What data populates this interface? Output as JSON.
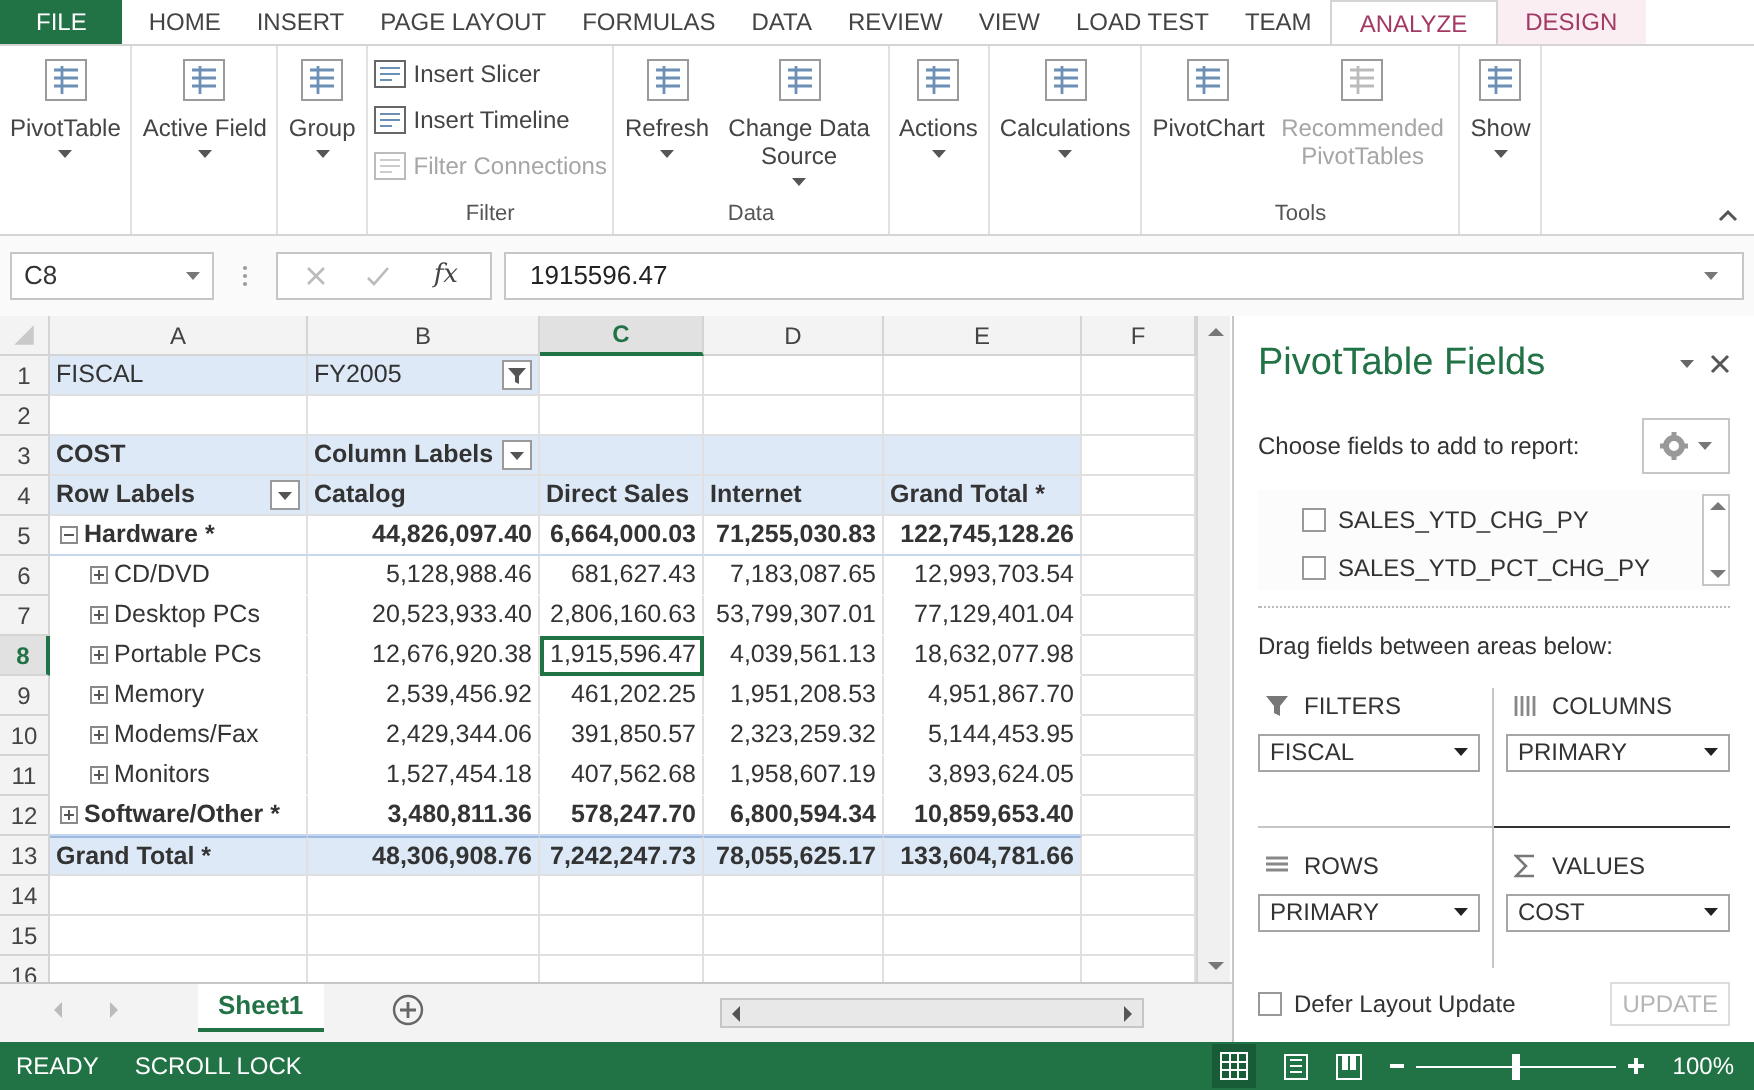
{
  "menu_tabs": [
    {
      "label": "FILE",
      "kind": "file",
      "selected": false
    },
    {
      "label": "HOME",
      "kind": "normal",
      "selected": false
    },
    {
      "label": "INSERT",
      "kind": "normal",
      "selected": false
    },
    {
      "label": "PAGE LAYOUT",
      "kind": "normal",
      "selected": false
    },
    {
      "label": "FORMULAS",
      "kind": "normal",
      "selected": false
    },
    {
      "label": "DATA",
      "kind": "normal",
      "selected": false
    },
    {
      "label": "REVIEW",
      "kind": "normal",
      "selected": false
    },
    {
      "label": "VIEW",
      "kind": "normal",
      "selected": false
    },
    {
      "label": "LOAD TEST",
      "kind": "normal",
      "selected": false
    },
    {
      "label": "TEAM",
      "kind": "normal",
      "selected": false
    },
    {
      "label": "ANALYZE",
      "kind": "context",
      "selected": true
    },
    {
      "label": "DESIGN",
      "kind": "context",
      "selected": false
    }
  ],
  "ribbon_groups": [
    {
      "kind": "large",
      "buttons": [
        {
          "label": "PivotTable",
          "caret": true,
          "disabled": false
        }
      ]
    },
    {
      "kind": "large",
      "buttons": [
        {
          "label": "Active Field",
          "caret": true,
          "disabled": false
        }
      ]
    },
    {
      "kind": "large",
      "buttons": [
        {
          "label": "Group",
          "caret": true,
          "disabled": false
        }
      ]
    },
    {
      "kind": "small",
      "label": "Filter",
      "buttons": [
        {
          "label": "Insert Slicer",
          "disabled": false
        },
        {
          "label": "Insert Timeline",
          "disabled": false
        },
        {
          "label": "Filter Connections",
          "disabled": true
        }
      ]
    },
    {
      "kind": "large",
      "label": "Data",
      "buttons": [
        {
          "label": "Refresh",
          "caret": true,
          "disabled": false
        },
        {
          "label": "Change Data Source",
          "caret": true,
          "disabled": false
        }
      ]
    },
    {
      "kind": "large",
      "buttons": [
        {
          "label": "Actions",
          "caret": true,
          "disabled": false
        }
      ]
    },
    {
      "kind": "large",
      "buttons": [
        {
          "label": "Calculations",
          "caret": true,
          "disabled": false
        }
      ]
    },
    {
      "kind": "large",
      "label": "Tools",
      "buttons": [
        {
          "label": "PivotChart",
          "caret": false,
          "disabled": false
        },
        {
          "label": "Recommended PivotTables",
          "caret": false,
          "disabled": true
        }
      ]
    },
    {
      "kind": "large",
      "buttons": [
        {
          "label": "Show",
          "caret": true,
          "disabled": false
        }
      ]
    }
  ],
  "formula_bar": {
    "name_box": "C8",
    "function_label": "fx",
    "value": "1915596.47"
  },
  "columns": [
    {
      "label": "A",
      "selected": false
    },
    {
      "label": "B",
      "selected": false
    },
    {
      "label": "C",
      "selected": true
    },
    {
      "label": "D",
      "selected": false
    },
    {
      "label": "E",
      "selected": false
    },
    {
      "label": "F",
      "selected": false
    }
  ],
  "rows": [
    {
      "num": "1",
      "kind": "filter",
      "selected": false,
      "cells": [
        "FISCAL",
        "FY2005"
      ]
    },
    {
      "num": "2",
      "kind": "empty",
      "selected": false
    },
    {
      "num": "3",
      "kind": "caption",
      "selected": false,
      "cells": [
        "COST",
        "Column Labels"
      ]
    },
    {
      "num": "4",
      "kind": "colheads",
      "selected": false,
      "cells": [
        "Row Labels",
        "Catalog",
        "Direct Sales",
        "Internet",
        "Grand Total *"
      ]
    },
    {
      "num": "5",
      "kind": "group",
      "expanded": true,
      "selected": false,
      "cells": [
        "Hardware *",
        "44,826,097.40",
        "6,664,000.03",
        "71,255,030.83",
        "122,745,128.26"
      ]
    },
    {
      "num": "6",
      "kind": "item",
      "expanded": false,
      "selected": false,
      "cells": [
        "CD/DVD",
        "5,128,988.46",
        "681,627.43",
        "7,183,087.65",
        "12,993,703.54"
      ]
    },
    {
      "num": "7",
      "kind": "item",
      "expanded": false,
      "selected": false,
      "cells": [
        "Desktop PCs",
        "20,523,933.40",
        "2,806,160.63",
        "53,799,307.01",
        "77,129,401.04"
      ]
    },
    {
      "num": "8",
      "kind": "item",
      "expanded": false,
      "selected": true,
      "cells": [
        "Portable PCs",
        "12,676,920.38",
        "1,915,596.47",
        "4,039,561.13",
        "18,632,077.98"
      ]
    },
    {
      "num": "9",
      "kind": "item",
      "expanded": false,
      "selected": false,
      "cells": [
        "Memory",
        "2,539,456.92",
        "461,202.25",
        "1,951,208.53",
        "4,951,867.70"
      ]
    },
    {
      "num": "10",
      "kind": "item",
      "expanded": false,
      "selected": false,
      "cells": [
        "Modems/Fax",
        "2,429,344.06",
        "391,850.57",
        "2,323,259.32",
        "5,144,453.95"
      ]
    },
    {
      "num": "11",
      "kind": "item",
      "expanded": false,
      "selected": false,
      "cells": [
        "Monitors",
        "1,527,454.18",
        "407,562.68",
        "1,958,607.19",
        "3,893,624.05"
      ]
    },
    {
      "num": "12",
      "kind": "group",
      "expanded": false,
      "selected": false,
      "cells": [
        "Software/Other *",
        "3,480,811.36",
        "578,247.70",
        "6,800,594.34",
        "10,859,653.40"
      ]
    },
    {
      "num": "13",
      "kind": "total",
      "selected": false,
      "cells": [
        "Grand Total *",
        "48,306,908.76",
        "7,242,247.73",
        "78,055,625.17",
        "133,604,781.66"
      ]
    },
    {
      "num": "14",
      "kind": "empty",
      "selected": false
    },
    {
      "num": "15",
      "kind": "empty",
      "selected": false
    },
    {
      "num": "16",
      "kind": "empty",
      "selected": false
    }
  ],
  "sheet_tabs": [
    {
      "label": "Sheet1",
      "selected": true
    }
  ],
  "pane": {
    "title": "PivotTable Fields",
    "subtitle": "Choose fields to add to report:",
    "fields": [
      {
        "label": "SALES_YTD_CHG_PY",
        "checked": false
      },
      {
        "label": "SALES_YTD_PCT_CHG_PY",
        "checked": false
      }
    ],
    "drag_hint": "Drag fields between areas below:",
    "areas": [
      {
        "kind": "filters",
        "label": "FILTERS",
        "fields": [
          "FISCAL"
        ]
      },
      {
        "kind": "columns",
        "label": "COLUMNS",
        "fields": [
          "PRIMARY"
        ]
      },
      {
        "kind": "rows",
        "label": "ROWS",
        "fields": [
          "PRIMARY"
        ]
      },
      {
        "kind": "values",
        "label": "VALUES",
        "fields": [
          "COST"
        ]
      }
    ],
    "defer": {
      "label": "Defer Layout Update",
      "checked": false
    },
    "update_button": {
      "label": "UPDATE",
      "disabled": true
    }
  },
  "status_bar": {
    "items": [
      "READY",
      "SCROLL LOCK"
    ],
    "zoom": "100%"
  }
}
